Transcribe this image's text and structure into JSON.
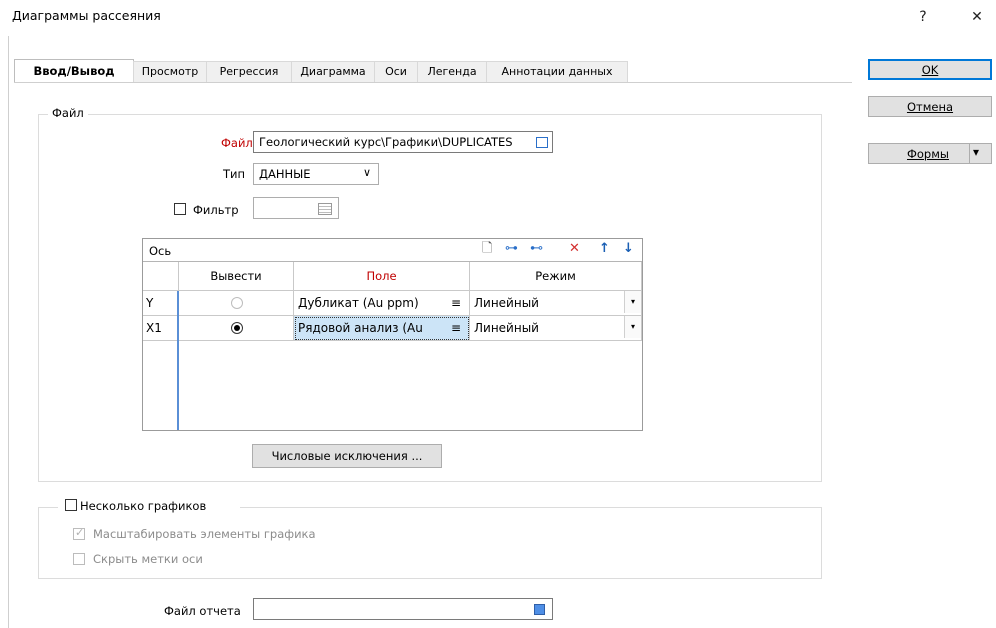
{
  "window": {
    "title": "Диаграммы рассеяния",
    "help_glyph": "?",
    "close_glyph": "✕"
  },
  "tabs": [
    {
      "label": "Ввод/Вывод",
      "active": true
    },
    {
      "label": "Просмотр"
    },
    {
      "label": "Регрессия"
    },
    {
      "label": "Диаграмма"
    },
    {
      "label": "Оси"
    },
    {
      "label": "Легенда"
    },
    {
      "label": "Аннотации данных"
    }
  ],
  "buttons": {
    "ok": "OK",
    "cancel": "Отмена",
    "forms": "Формы",
    "forms_arrow": "▾"
  },
  "file_group": {
    "legend": "Файл",
    "file_label": "Файл",
    "file_value": "Геологический курс\\Графики\\DUPLICATES",
    "type_label": "Тип",
    "type_value": "ДАННЫЕ",
    "type_arrow": "∨",
    "filter_label": "Фильтр",
    "filter_value": ""
  },
  "grid": {
    "title": "Ось",
    "toolbar": {
      "new_glyph": "🗋",
      "insert_glyph": "⊶",
      "append_glyph": "⊷",
      "delete_glyph": "✕",
      "up_glyph": "↑",
      "down_glyph": "↓"
    },
    "columns": [
      "Вывести",
      "Поле",
      "Режим"
    ],
    "rows": [
      {
        "axis": "Y",
        "output": false,
        "field": "Дубликат (Au ppm)",
        "mode": "Линейный"
      },
      {
        "axis": "X1",
        "output": true,
        "field": "Рядовой анализ (Au",
        "mode": "Линейный"
      }
    ],
    "field_menu_glyph": "≡",
    "mode_arrow": "▾"
  },
  "numeric_exclusions_button": "Числовые исключения ...",
  "multi_group": {
    "label": "Несколько графиков",
    "scale_label": "Масштабировать элементы графика",
    "hide_label": "Скрыть метки оси",
    "check_glyph": "✓"
  },
  "report": {
    "label": "Файл отчета",
    "value": ""
  },
  "colors": {
    "accent": "#0078d7",
    "required_label": "#c00000",
    "selected_cell": "#cce4f7"
  }
}
